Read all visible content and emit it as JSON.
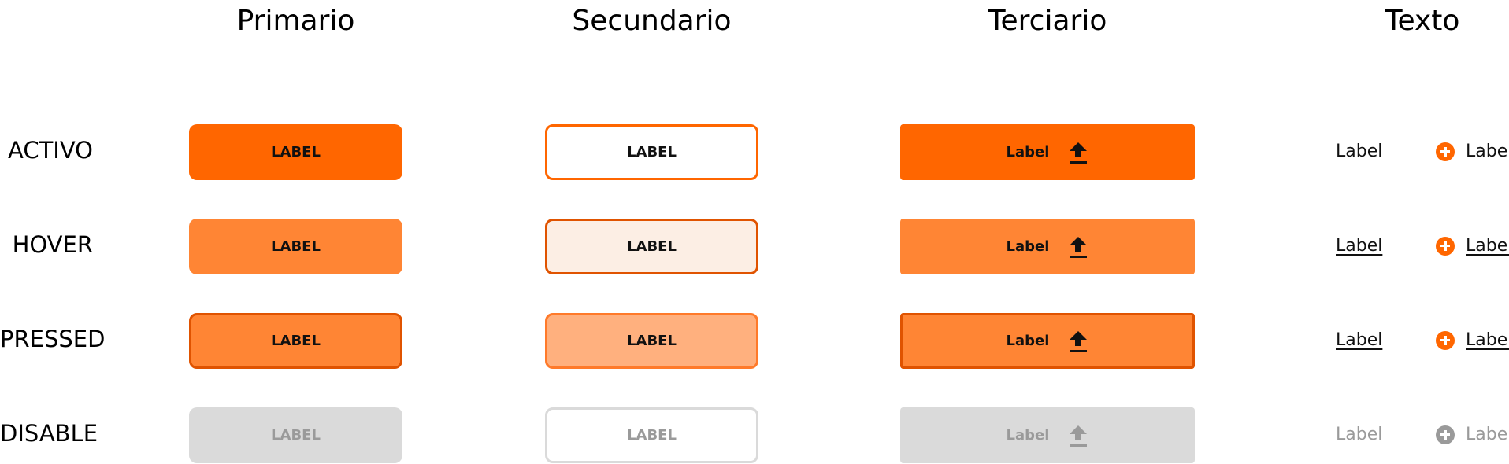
{
  "columns": {
    "primary": "Primario",
    "secondary": "Secundario",
    "tertiary": "Terciario",
    "text": "Texto"
  },
  "rows": {
    "active": "ACTIVO",
    "hover": "HOVER",
    "pressed": "PRESSED",
    "disabled": "DISABLE"
  },
  "button_label": "LABEL",
  "text_label": "Label",
  "icons": {
    "tertiary": "upload-icon",
    "text": "plus-circle-icon"
  },
  "colors": {
    "primary_active": "#FF6600",
    "primary_hover": "#FF8534",
    "primary_pressed_border": "#E05300",
    "secondary_hover_fill": "#FCEEE4",
    "secondary_pressed_fill": "#FFB07E",
    "disabled_fill": "#DADADA",
    "disabled_text": "#9A9A9A"
  }
}
